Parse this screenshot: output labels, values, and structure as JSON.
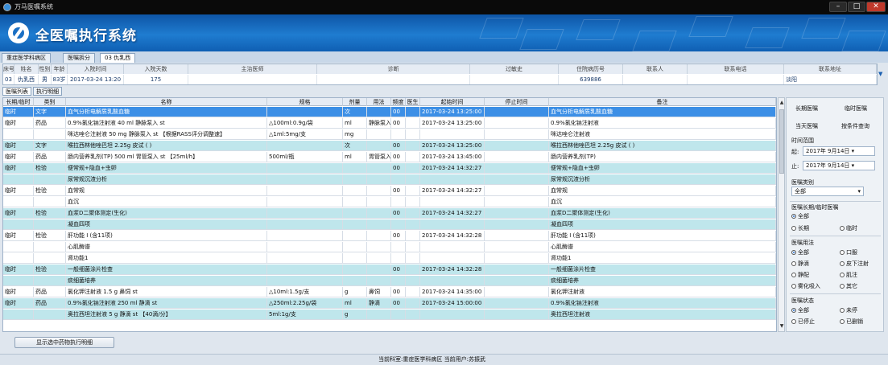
{
  "window": {
    "title": "万马医嘱系统",
    "min": "–",
    "max": "□",
    "close": "✕"
  },
  "header": {
    "system_title": "全医嘱执行系统"
  },
  "tabs": [
    {
      "label": "重症医学科病区"
    },
    {
      "label": "医嘱拆分"
    },
    {
      "label": "03 仇乳西"
    }
  ],
  "patient": {
    "headers": [
      "床号",
      "姓名",
      "性别",
      "年龄",
      "入院时间",
      "入院天数",
      "主治医师",
      "诊断",
      "过敏史",
      "住院病历号",
      "联系人",
      "联系电话",
      "联系地址"
    ],
    "values": [
      "03",
      "仇乳西",
      "男",
      "83岁",
      "2017-03-24 13:20",
      "175",
      "",
      "",
      "",
      "639886",
      "",
      "",
      "淡阳"
    ]
  },
  "subtabs": [
    {
      "label": "医嘱列表"
    },
    {
      "label": "执行明细"
    }
  ],
  "grid": {
    "headers": [
      "长期/临时",
      "类别",
      "名称",
      "规格",
      "剂量",
      "用法",
      "频度",
      "医生",
      "起始时间",
      "停止时间",
      "备注"
    ],
    "rows": [
      {
        "style": "selected",
        "cells": [
          "临时",
          "文字",
          "血气分析电解质乳酸血糖",
          "",
          "次",
          "",
          "00",
          "",
          "2017-03-24 13:25:00",
          "",
          "血气分析电解质乳酸血糖"
        ]
      },
      {
        "style": "white",
        "cells": [
          "临时",
          "药品",
          "0.9%氯化钠注射液 40 ml 静脉泵入 st",
          "△100ml:0.9g/袋",
          "ml",
          "静脉泵入",
          "00",
          "",
          "2017-03-24 13:25:00",
          "",
          "0.9%氯化钠注射液"
        ]
      },
      {
        "style": "white",
        "cells": [
          "",
          "",
          "咪达唑仑注射液 50 mg 静脉泵入 st 【根据RASS评分调整速】",
          "△1ml:5mg/支",
          "mg",
          "",
          "",
          "",
          "",
          "",
          "咪达唑仑注射液"
        ]
      },
      {
        "style": "cyan",
        "cells": [
          "临时",
          "文字",
          "喉拉西林他唑巴坦 2.25g 皮试 ( )",
          "",
          "次",
          "",
          "00",
          "",
          "2017-03-24 13:25:00",
          "",
          "喉拉西林他唑巴坦 2.25g 皮试 ( )"
        ]
      },
      {
        "style": "white",
        "cells": [
          "临时",
          "药品",
          "肠内营养乳剂(TP) 500 ml 胃管泵入 st 【25ml/h】",
          "500ml/瓶",
          "ml",
          "胃管泵入",
          "00",
          "",
          "2017-03-24 13:45:00",
          "",
          "肠内营养乳剂(TP)"
        ]
      },
      {
        "style": "cyan",
        "cells": [
          "临时",
          "检验",
          "便常规+隐血+虫卵",
          "",
          "",
          "",
          "00",
          "",
          "2017-03-24 14:32:27",
          "",
          "便常规+隐血+虫卵"
        ]
      },
      {
        "style": "cyan",
        "cells": [
          "",
          "",
          "尿常规沉渣分析",
          "",
          "",
          "",
          "",
          "",
          "",
          "",
          "尿常规沉渣分析"
        ]
      },
      {
        "style": "white",
        "cells": [
          "临时",
          "检验",
          "血常规",
          "",
          "",
          "",
          "00",
          "",
          "2017-03-24 14:32:27",
          "",
          "血常规"
        ]
      },
      {
        "style": "white",
        "cells": [
          "",
          "",
          "血沉",
          "",
          "",
          "",
          "",
          "",
          "",
          "",
          "血沉"
        ]
      },
      {
        "style": "cyan",
        "cells": [
          "临时",
          "检验",
          "血浆D二聚体测定(生化)",
          "",
          "",
          "",
          "00",
          "",
          "2017-03-24 14:32:27",
          "",
          "血浆D二聚体测定(生化)"
        ]
      },
      {
        "style": "cyan",
        "cells": [
          "",
          "",
          "凝血四项",
          "",
          "",
          "",
          "",
          "",
          "",
          "",
          "凝血四项"
        ]
      },
      {
        "style": "white",
        "cells": [
          "临时",
          "检验",
          "肝功能 I (含11项)",
          "",
          "",
          "",
          "00",
          "",
          "2017-03-24 14:32:28",
          "",
          "肝功能 I (含11项)"
        ]
      },
      {
        "style": "white",
        "cells": [
          "",
          "",
          "心肌酶谱",
          "",
          "",
          "",
          "",
          "",
          "",
          "",
          "心肌酶谱"
        ]
      },
      {
        "style": "white",
        "cells": [
          "",
          "",
          "肾功能1",
          "",
          "",
          "",
          "",
          "",
          "",
          "",
          "肾功能1"
        ]
      },
      {
        "style": "cyan",
        "cells": [
          "临时",
          "检验",
          "一般细菌涂片检查",
          "",
          "",
          "",
          "00",
          "",
          "2017-03-24 14:32:28",
          "",
          "一般细菌涂片检查"
        ]
      },
      {
        "style": "cyan",
        "cells": [
          "",
          "",
          "痰细菌培养",
          "",
          "",
          "",
          "",
          "",
          "",
          "",
          "痰细菌培养"
        ]
      },
      {
        "style": "white",
        "cells": [
          "临时",
          "药品",
          "氯化钾注射液 1.5 g 鼻饲 st",
          "△10ml:1.5g/支",
          "g",
          "鼻饲",
          "00",
          "",
          "2017-03-24 14:35:00",
          "",
          "氯化钾注射液"
        ]
      },
      {
        "style": "cyan",
        "cells": [
          "临时",
          "药品",
          "0.9%氯化钠注射液 250 ml 静滴 st",
          "△250ml:2.25g/袋",
          "ml",
          "静滴",
          "00",
          "",
          "2017-03-24 15:00:00",
          "",
          "0.9%氯化钠注射液"
        ]
      },
      {
        "style": "cyan",
        "cells": [
          "",
          "",
          "奥拉西坦注射液 5 g 静滴 st 【40滴/分】",
          "5ml:1g/支",
          "g",
          "",
          "",
          "",
          "",
          "",
          "奥拉西坦注射液"
        ]
      }
    ]
  },
  "panel": {
    "btn_long": "长期医嘱",
    "btn_temp": "临时医嘱",
    "btn_today": "当天医嘱",
    "btn_query": "按条件查询",
    "time_range": "时间范围",
    "from_label": "起:",
    "from_value": "2017年 9月14日",
    "to_label": "止:",
    "to_value": "2017年 9月14日",
    "category_label": "医嘱类别",
    "category_value": "全部",
    "longtemp_label": "医嘱长期/临时医嘱",
    "lt_all": "全部",
    "lt_long": "长期",
    "lt_temp": "临时",
    "usage_label": "医嘱用法",
    "u_all": "全部",
    "u_oral": "口服",
    "u_drip": "静滴",
    "u_subq": "皮下注射",
    "u_push": "静配",
    "u_im": "肌注",
    "u_neb": "雾化吸入",
    "u_other": "其它",
    "status_label": "医嘱状态",
    "s_all": "全部",
    "s_unstop": "未停",
    "s_stopped": "已停止",
    "s_deleted": "已删销"
  },
  "footer": {
    "button": "显示选中药物执行明细",
    "status": "当前科室:重症医学科病区   当前用户:苏振武"
  },
  "colors": {
    "header_blue": "#1a6fc4",
    "row_cyan": "#bfe6ec",
    "row_selected": "#3c8fe6"
  }
}
